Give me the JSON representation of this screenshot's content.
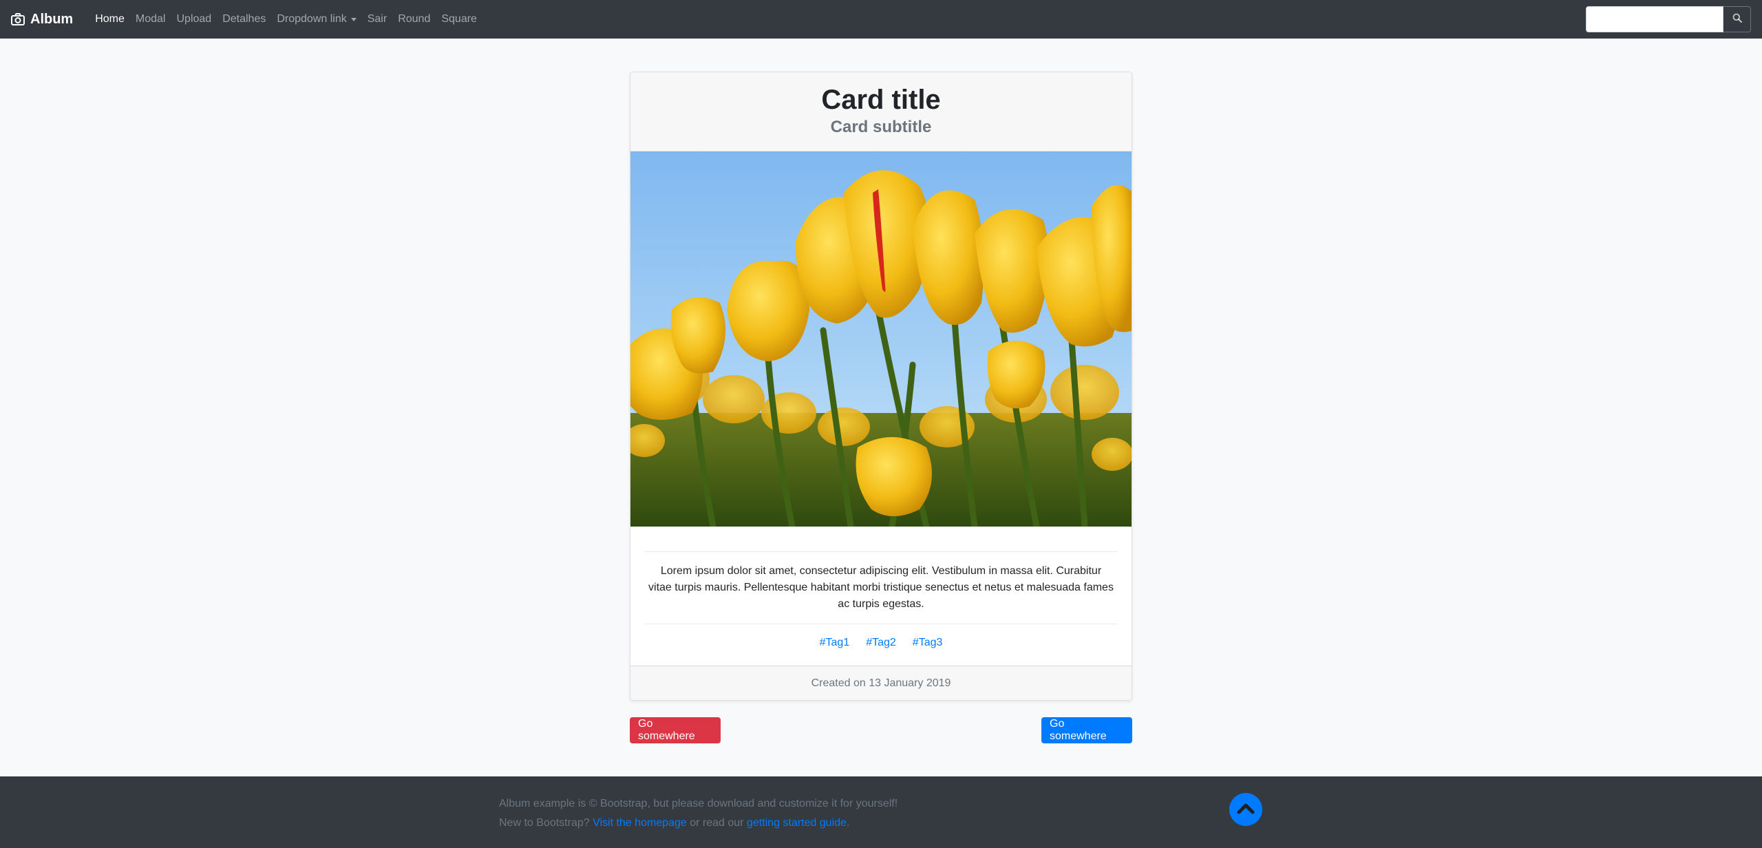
{
  "navbar": {
    "brand": "Album",
    "brand_icon": "camera-icon",
    "items": [
      {
        "label": "Home",
        "active": true
      },
      {
        "label": "Modal"
      },
      {
        "label": "Upload"
      },
      {
        "label": "Detalhes"
      },
      {
        "label": "Dropdown link",
        "dropdown": true
      },
      {
        "label": "Sair"
      },
      {
        "label": "Round"
      },
      {
        "label": "Square"
      }
    ],
    "search": {
      "placeholder": "",
      "value": "",
      "icon": "search-icon"
    }
  },
  "card": {
    "title": "Card title",
    "subtitle": "Card subtitle",
    "image_subject": "yellow tulips against blue sky",
    "text": "Lorem ipsum dolor sit amet, consectetur adipiscing elit. Vestibulum in massa elit. Curabitur vitae turpis mauris. Pellentesque habitant morbi tristique senectus et netus et malesuada fames ac turpis egestas.",
    "tags": [
      "#Tag1",
      "#Tag2",
      "#Tag3"
    ],
    "footer": "Created on 13 January 2019"
  },
  "buttons": {
    "left": "Go somewhere",
    "right": "Go somewhere"
  },
  "footer": {
    "line1": "Album example is © Bootstrap, but please download and customize it for yourself!",
    "line2_prefix": "New to Bootstrap? ",
    "link1": "Visit the homepage",
    "line2_middle": " or read our ",
    "link2": "getting started guide",
    "line2_suffix": ".",
    "to_top_icon": "chevron-up-icon"
  },
  "colors": {
    "navbar": "#343a40",
    "primary": "#007bff",
    "danger": "#dc3545",
    "body": "#f8f9fa"
  }
}
